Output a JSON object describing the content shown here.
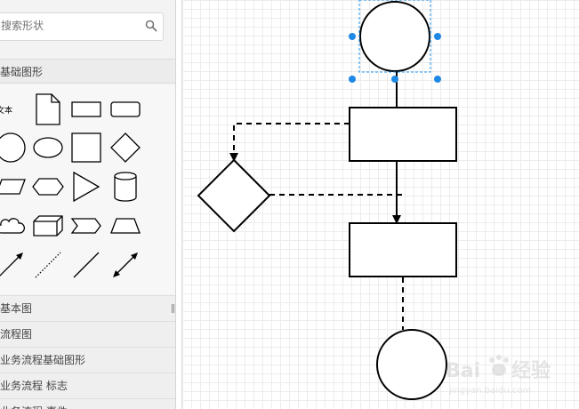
{
  "sidebar": {
    "search": {
      "placeholder": "搜索形状",
      "value": ""
    },
    "section_basic": "基础图形",
    "shape_text_label": "文本",
    "libraries": [
      "基本图",
      "流程图",
      "业务流程基础图形",
      "业务流程 标志",
      "业务流程 事件"
    ]
  },
  "canvas": {
    "selected_shape": "circle-top"
  },
  "watermark": {
    "brand": "Bai",
    "brand2": "经验",
    "sub": "jingyan.baidu.com"
  },
  "colors": {
    "selection_handle": "#1e88e5",
    "selection_outline": "#2196f3",
    "shape_stroke": "#000000",
    "grid": "#ececec"
  }
}
